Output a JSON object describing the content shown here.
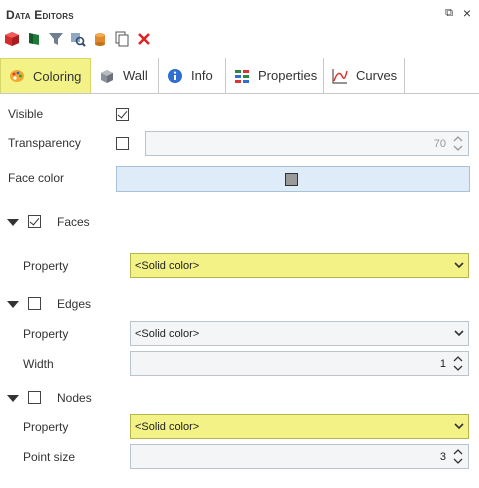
{
  "window": {
    "title": "Data Editors",
    "restore_label": "⧉",
    "close_label": "×"
  },
  "toolbar": {
    "icons": [
      "red-cube-icon",
      "green-flag-icon",
      "funnel-icon",
      "search-grid-icon",
      "cylinder-icon",
      "copy-icon",
      "delete-icon"
    ]
  },
  "tabs": [
    {
      "label": "Coloring",
      "icon": "palette-icon",
      "active": true
    },
    {
      "label": "Wall",
      "icon": "wall-icon",
      "active": false
    },
    {
      "label": "Info",
      "icon": "info-icon",
      "active": false
    },
    {
      "label": "Properties",
      "icon": "properties-icon",
      "active": false
    },
    {
      "label": "Curves",
      "icon": "curves-icon",
      "active": false
    }
  ],
  "general": {
    "visible_label": "Visible",
    "visible_checked": true,
    "transparency_label": "Transparency",
    "transparency_checked": false,
    "transparency_value": "70",
    "face_color_label": "Face color",
    "face_color": "#9a9a9a"
  },
  "faces": {
    "label": "Faces",
    "checked": true,
    "property_label": "Property",
    "property_value": "<Solid color>"
  },
  "edges": {
    "label": "Edges",
    "checked": false,
    "property_label": "Property",
    "property_value": "<Solid color>",
    "width_label": "Width",
    "width_value": "1"
  },
  "nodes": {
    "label": "Nodes",
    "checked": false,
    "property_label": "Property",
    "property_value": "<Solid color>",
    "point_size_label": "Point size",
    "point_size_value": "3"
  },
  "colors": {
    "highlight": "#f3f287",
    "field_bg": "#f3f5f7",
    "face_bg": "#ddecf8"
  }
}
